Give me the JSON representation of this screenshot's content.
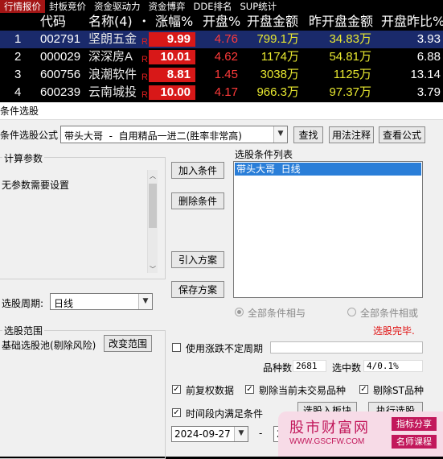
{
  "tabs": [
    "行情报价",
    "封板竞价",
    "资金驱动力",
    "资金博弈",
    "DDE排名",
    "SUP统计"
  ],
  "columns": {
    "code": "代码",
    "name": "名称(4)",
    "name_marker": "•",
    "change": "涨幅%",
    "open": "开盘%",
    "open_amount": "开盘金额",
    "prev_open_amount": "昨开盘金额",
    "ratio": "开盘昨比%"
  },
  "rows": [
    {
      "index": "1",
      "code": "002791",
      "name": "坚朗五金",
      "flag": "R",
      "change": "9.99",
      "open": "4.76",
      "open_amount": "799.1万",
      "prev_open_amount": "34.83万",
      "ratio": "3.93"
    },
    {
      "index": "2",
      "code": "000029",
      "name": "深深房A",
      "flag": "R",
      "change": "10.01",
      "open": "4.62",
      "open_amount": "1174万",
      "prev_open_amount": "54.81万",
      "ratio": "6.88"
    },
    {
      "index": "3",
      "code": "600756",
      "name": "浪潮软件",
      "flag": "R",
      "change": "8.81",
      "open": "1.45",
      "open_amount": "3038万",
      "prev_open_amount": "1125万",
      "ratio": "13.14"
    },
    {
      "index": "4",
      "code": "600239",
      "name": "云南城投",
      "flag": "R",
      "change": "10.00",
      "open": "4.17",
      "open_amount": "966.3万",
      "prev_open_amount": "97.37万",
      "ratio": "3.79"
    }
  ],
  "dialog": {
    "title": "条件选股",
    "formula_label": "条件选股公式",
    "formula_value": "带头大哥  -  自用精品一进二(胜率非常高)",
    "find_button": "查找",
    "usage_button": "用法注释",
    "view_button": "查看公式",
    "params_group": "计算参数",
    "params_text": "无参数需要设置",
    "add_button": "加入条件",
    "delete_button": "删除条件",
    "import_button": "引入方案",
    "save_button": "保存方案",
    "list_label": "选股条件列表",
    "list_items": [
      "带头大哥  日线"
    ],
    "period_label": "选股周期:",
    "period_value": "日线",
    "radio_and": "全部条件相与",
    "radio_or": "全部条件相或",
    "status": "选股完毕.",
    "scope_group": "选股范围",
    "scope_text": "基础选股池(剔除风险)",
    "change_scope_button": "改变范围",
    "use_period_label": "使用涨跌不定周期",
    "count_label": "品种数",
    "count_value": "2681",
    "selected_label": "选中数",
    "selected_value": "4/0.1%",
    "chk_rights": "前复权数据",
    "chk_exclude_untraded": "剔除当前未交易品种",
    "chk_exclude_st": "剔除ST品种",
    "chk_time_range": "时间段内满足条件",
    "to_block_button": "选股入板块",
    "run_button": "执行选股",
    "date_start": "2024-09-27",
    "date_sep": "-",
    "date_end": "2"
  },
  "watermark": {
    "line1": "股市财富网",
    "line2": "WWW.GSCFW.COM",
    "tag1": "指标分享",
    "tag2": "名师课程"
  }
}
